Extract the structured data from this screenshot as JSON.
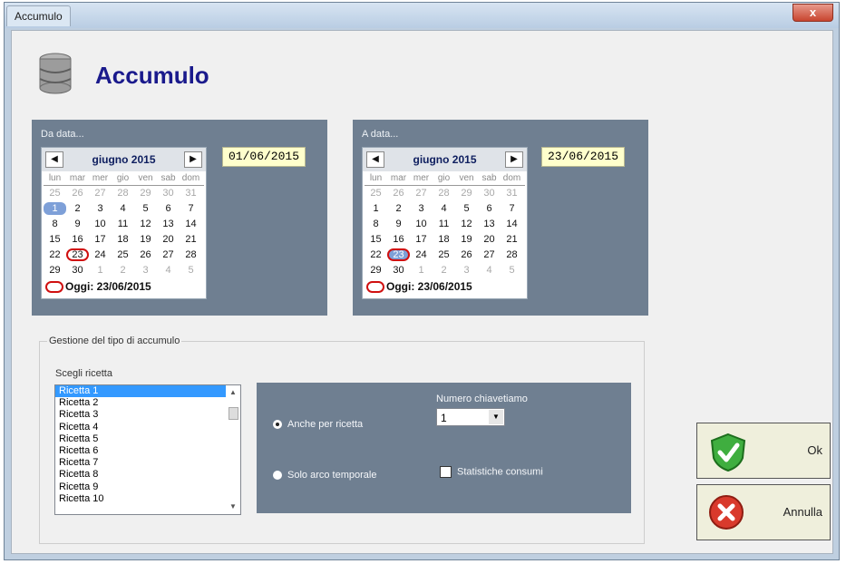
{
  "window": {
    "title": "Accumulo",
    "close_label": "x"
  },
  "header": {
    "title": "Accumulo",
    "icon": "database-icon"
  },
  "from_date": {
    "label": "Da data...",
    "month_label": "giugno 2015",
    "value": "01/06/2015",
    "selected_day": "1",
    "today_text": "Oggi: 23/06/2015"
  },
  "to_date": {
    "label": "A data...",
    "month_label": "giugno 2015",
    "value": "23/06/2015",
    "selected_day": "23",
    "today_text": "Oggi: 23/06/2015"
  },
  "calendar": {
    "weekdays": [
      "lun",
      "mar",
      "mer",
      "gio",
      "ven",
      "sab",
      "dom"
    ],
    "weeks": [
      [
        "25",
        "26",
        "27",
        "28",
        "29",
        "30",
        "31"
      ],
      [
        "1",
        "2",
        "3",
        "4",
        "5",
        "6",
        "7"
      ],
      [
        "8",
        "9",
        "10",
        "11",
        "12",
        "13",
        "14"
      ],
      [
        "15",
        "16",
        "17",
        "18",
        "19",
        "20",
        "21"
      ],
      [
        "22",
        "23",
        "24",
        "25",
        "26",
        "27",
        "28"
      ],
      [
        "29",
        "30",
        "1",
        "2",
        "3",
        "4",
        "5"
      ]
    ]
  },
  "group": {
    "label": "Gestione del tipo di accumulo",
    "recipe_label": "Scegli ricetta",
    "recipes": [
      "Ricetta 1",
      "Ricetta 2",
      "Ricetta 3",
      "Ricetta 4",
      "Ricetta 5",
      "Ricetta 6",
      "Ricetta 7",
      "Ricetta 8",
      "Ricetta 9",
      "Ricetta 10"
    ],
    "selected_recipe": "Ricetta 1"
  },
  "options": {
    "radio_per_recipe": "Anche per ricetta",
    "radio_time_only": "Solo arco temporale",
    "key_count_label": "Numero chiavetiamo",
    "key_count_value": "1",
    "stats_label": "Statistiche consumi"
  },
  "buttons": {
    "ok": "Ok",
    "cancel": "Annulla"
  }
}
